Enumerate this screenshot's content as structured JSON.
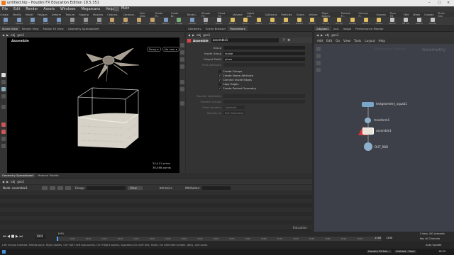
{
  "window": {
    "title": "untitled.hip - Houdini FX Education Edition 18.5.351"
  },
  "menu": [
    "File",
    "Edit",
    "Render",
    "Assets",
    "Windows",
    "Megascans",
    "Help"
  ],
  "desktop_label": "Main",
  "shelf_tabs": [
    "Create",
    "Modify",
    "Model",
    "Polygon",
    "Deform",
    "Texture",
    "Rigging",
    "Muscles",
    "Charact..",
    "Constrai..",
    "Hair Utils",
    "Guide Pr..",
    "Guide Br..",
    "Terrain..",
    "Simple FX",
    "Cloud FX",
    "Volume",
    "Lights and..",
    "Collisions",
    "Particles",
    "Grains",
    "Vellum",
    "Rigid Bodies",
    "Particle Fl..",
    "Viscous Fl..",
    "Oceans",
    "Pyro FX",
    "FEM",
    "Wires",
    "Crowds",
    "Drive Sim"
  ],
  "shelf_tools": [
    {
      "label": "Box",
      "color": "#7a9cc4"
    },
    {
      "label": "Sphere",
      "color": "#7a9cc4"
    },
    {
      "label": "Tube",
      "color": "#7a9cc4"
    },
    {
      "label": "Torus",
      "color": "#7a9cc4"
    },
    {
      "label": "Grid",
      "color": "#7a9cc4"
    },
    {
      "label": "Null",
      "color": "#999"
    },
    {
      "label": "Line",
      "color": "#999"
    },
    {
      "label": "Circle",
      "color": "#999"
    },
    {
      "label": "Curve Bezier",
      "color": "#c9a46a"
    },
    {
      "label": "Draw Curve",
      "color": "#c9a46a"
    },
    {
      "label": "Path",
      "color": "#c9a46a"
    },
    {
      "label": "Spray Paint",
      "color": "#c9a46a"
    },
    {
      "label": "Platonic",
      "color": "#7a9cc4"
    },
    {
      "label": "L-System",
      "color": "#7ab07a"
    },
    {
      "label": "Metaball",
      "color": "#7a9cc4"
    },
    {
      "label": "File",
      "color": "#aaa"
    },
    {
      "label": "Camera",
      "color": "#c6c6c6"
    },
    {
      "label": "Point Light",
      "color": "#e0c060"
    },
    {
      "label": "Spot Light",
      "color": "#e0c060"
    },
    {
      "label": "Area Light",
      "color": "#e0c060"
    },
    {
      "label": "Geometry Light",
      "color": "#e0c060"
    },
    {
      "label": "Volume Light",
      "color": "#e0c060"
    },
    {
      "label": "Distant Light",
      "color": "#e0c060"
    },
    {
      "label": "Environment",
      "color": "#e0c060"
    },
    {
      "label": "Sky Light",
      "color": "#e0c060"
    },
    {
      "label": "GI Light",
      "color": "#e0c060"
    },
    {
      "label": "Caustic Light",
      "color": "#e0c060"
    },
    {
      "label": "Portal Light",
      "color": "#e0c060"
    },
    {
      "label": "Ambient Light",
      "color": "#e0c060"
    },
    {
      "label": "Stereo Camera",
      "color": "#c6c6c6"
    },
    {
      "label": "VR Camera",
      "color": "#c6c6c6"
    },
    {
      "label": "Switcher",
      "color": "#c6c6c6"
    },
    {
      "label": "Gamepad Cam",
      "color": "#c6c6c6"
    }
  ],
  "left_tabs": [
    "Scene View",
    "Render View",
    "Motion FX View",
    "Geometry Spreadsheet"
  ],
  "left_path": [
    "obj",
    "geo1"
  ],
  "viewport": {
    "title": "Assemble",
    "persp": "Persp ▾",
    "cam": "No cam ▾",
    "stats_points": "20,411  prims",
    "stats_prims": "38,468 points"
  },
  "param_tabs": [
    "Geometry",
    "Scene Browser",
    "Parameters"
  ],
  "param_path": [
    "obj",
    "geo1"
  ],
  "node_header": {
    "type": "Assemble",
    "name": "assemble1"
  },
  "params": [
    {
      "label": "Group",
      "value": ""
    },
    {
      "label": "Inside Group",
      "value": "inside"
    },
    {
      "label": "Output Prefix",
      "value": "piece"
    },
    {
      "label": "Pack Attribute",
      "value": ""
    }
  ],
  "checkboxes": [
    {
      "label": "Create Groups",
      "checked": false
    },
    {
      "label": "Create Name Attribute",
      "checked": true
    },
    {
      "label": "Connect Inside Edges",
      "checked": true
    },
    {
      "label": "Copy Edges",
      "checked": false
    },
    {
      "label": "Create Packed Geometry",
      "checked": true
    }
  ],
  "params2": [
    {
      "label": "Transfer Attributes",
      "value": ""
    },
    {
      "label": "Transfer Groups",
      "value": ""
    },
    {
      "label": "Pivot Location",
      "value": "Centroid"
    },
    {
      "label": "Display As",
      "value": "Full Geometry"
    }
  ],
  "net_tabs": [
    "/obj/geo1",
    "/out",
    "/stage",
    "Performance Monitor"
  ],
  "net_menu": [
    "Add",
    "Edit",
    "Go",
    "View",
    "Tools",
    "Layout",
    "Help"
  ],
  "net_path": [
    "obj",
    "geo1"
  ],
  "net_watermark": "Education Edition",
  "net_context": "Geometry",
  "nodes": [
    {
      "name": "testgeometry_squab1"
    },
    {
      "name": "transform1"
    },
    {
      "name": "assemble1"
    },
    {
      "name": "OUT_RBD"
    }
  ],
  "bottom_tabs": [
    "Geometry Spreadsheet",
    "Material Palette"
  ],
  "bottom_path": [
    "obj",
    "geo1"
  ],
  "bottom_toolbar": {
    "node": "Node: assemble1",
    "group_label": "Group:",
    "view_label": "View",
    "intrinsics": "Intrinsics",
    "attributes": "Attributes:"
  },
  "bottom_status": "Education",
  "timeline": {
    "frame": "1001",
    "start": "1001",
    "end": "1100",
    "end2": "1100",
    "ticks": [
      "1005",
      "1010",
      "1015",
      "1020",
      "1025",
      "1030",
      "1035",
      "1040",
      "1045",
      "1050",
      "1055",
      "1060",
      "1065",
      "1070",
      "1075",
      "1080",
      "1085",
      "1090",
      "1095"
    ],
    "keys": "0 keys, 0/0 channels",
    "key_all": "Key All Channels",
    "auto_update": "Auto Update"
  },
  "status_text": "Left mouse tumbles. Middle pans. Right dollies. Ctrl+Alt+Left box-zooms. Ctrl+Right zooms. Spacebar-Ctrl-Left tilts. Hold L for alternate tumble, dolly, and zoom.",
  "taskbar": {
    "app1": "Houdini FX Edu...",
    "app2": "Untitled - Paint",
    "time": "18:25"
  }
}
